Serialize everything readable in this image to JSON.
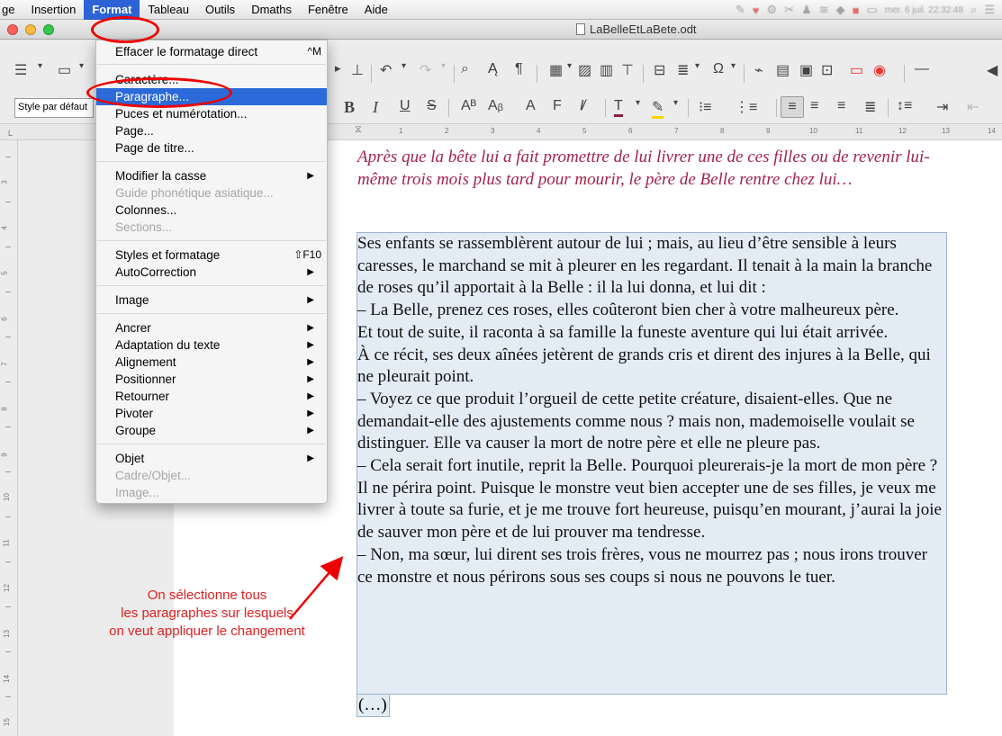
{
  "menubar": {
    "items": [
      "ge",
      "Insertion",
      "Format",
      "Tableau",
      "Outils",
      "Dmaths",
      "Fenêtre",
      "Aide"
    ],
    "status": {
      "datetime": "mer. 6 juil. 22:32:48"
    }
  },
  "window": {
    "title": "LaBelleEtLaBete.odt"
  },
  "toolbar": {
    "paragraph_style": "Style par défaut"
  },
  "ruler": {
    "numbers": [
      "1",
      "2",
      "3",
      "4",
      "5",
      "6",
      "7",
      "8",
      "9",
      "10",
      "11",
      "12",
      "13",
      "14"
    ],
    "vertical_numbers": [
      "3",
      "4",
      "5",
      "6",
      "7",
      "8",
      "9",
      "10",
      "11",
      "12",
      "13",
      "14",
      "15"
    ],
    "corner": "L"
  },
  "format_menu": {
    "groups": [
      [
        {
          "label": "Effacer le formatage direct",
          "shortcut": "^M"
        }
      ],
      [
        {
          "label": "Caractère..."
        },
        {
          "label": "Paragraphe...",
          "selected": true
        },
        {
          "label": "Puces et numérotation..."
        },
        {
          "label": "Page..."
        },
        {
          "label": "Page de titre..."
        }
      ],
      [
        {
          "label": "Modifier la casse",
          "submenu": true
        },
        {
          "label": "Guide phonétique asiatique...",
          "disabled": true
        },
        {
          "label": "Colonnes..."
        },
        {
          "label": "Sections...",
          "disabled": true
        }
      ],
      [
        {
          "label": "Styles et formatage",
          "shortcut": "⇧F10"
        },
        {
          "label": "AutoCorrection",
          "submenu": true
        }
      ],
      [
        {
          "label": "Image",
          "submenu": true
        }
      ],
      [
        {
          "label": "Ancrer",
          "submenu": true
        },
        {
          "label": "Adaptation du texte",
          "submenu": true
        },
        {
          "label": "Alignement",
          "submenu": true
        },
        {
          "label": "Positionner",
          "submenu": true
        },
        {
          "label": "Retourner",
          "submenu": true
        },
        {
          "label": "Pivoter",
          "submenu": true
        },
        {
          "label": "Groupe",
          "submenu": true
        }
      ],
      [
        {
          "label": "Objet",
          "submenu": true
        },
        {
          "label": "Cadre/Objet...",
          "disabled": true
        },
        {
          "label": "Image...",
          "disabled": true
        }
      ]
    ]
  },
  "document": {
    "heading": "Après que la bête lui a fait promettre de lui livrer une de ces filles ou de revenir lui-même trois mois plus tard pour mourir, le père de Belle rentre chez lui…",
    "paragraphs": [
      "Ses enfants se rassemblèrent autour de lui ; mais, au lieu d’être sensible à leurs caresses, le marchand se mit à pleurer en les regardant. Il tenait à la main la branche de roses qu’il apportait à la Belle : il la lui donna, et lui dit :",
      "– La Belle, prenez ces roses, elles coûteront bien cher à votre malheureux père.",
      "Et tout de suite, il raconta à sa famille la funeste aventure qui lui était arrivée.",
      "À ce récit, ses deux aînées jetèrent de grands cris et dirent des injures à la Belle, qui ne pleurait point.",
      "– Voyez ce que produit l’orgueil de cette petite créature, disaient-elles. Que ne demandait-elle des ajustements comme nous ? mais non, mademoiselle voulait se distinguer. Elle va causer la mort de notre père et elle ne pleure pas.",
      "– Cela serait fort inutile, reprit la Belle. Pourquoi pleurerais-je la mort de mon père ? Il ne périra point. Puisque le monstre veut bien accepter une de ses filles, je veux me livrer à toute sa furie, et je me trouve fort heureuse, puisqu’en mourant, j’aurai la joie de sauver mon père et de lui prouver ma tendresse.",
      "– Non, ma sœur, lui dirent ses trois frères, vous ne mourrez pas ; nous irons trouver ce monstre et nous périrons sous ses coups si nous ne pouvons le tuer."
    ],
    "ellipsis": "(…)"
  },
  "annotation": {
    "lines": [
      "On sélectionne tous",
      "les paragraphes sur lesquels",
      "on veut appliquer le changement"
    ],
    "color": "#e02020"
  },
  "colors": {
    "accent": "#2b6ad8",
    "heading": "#a3234a",
    "selection": "#e3ebf5",
    "annotation": "#e00000"
  }
}
